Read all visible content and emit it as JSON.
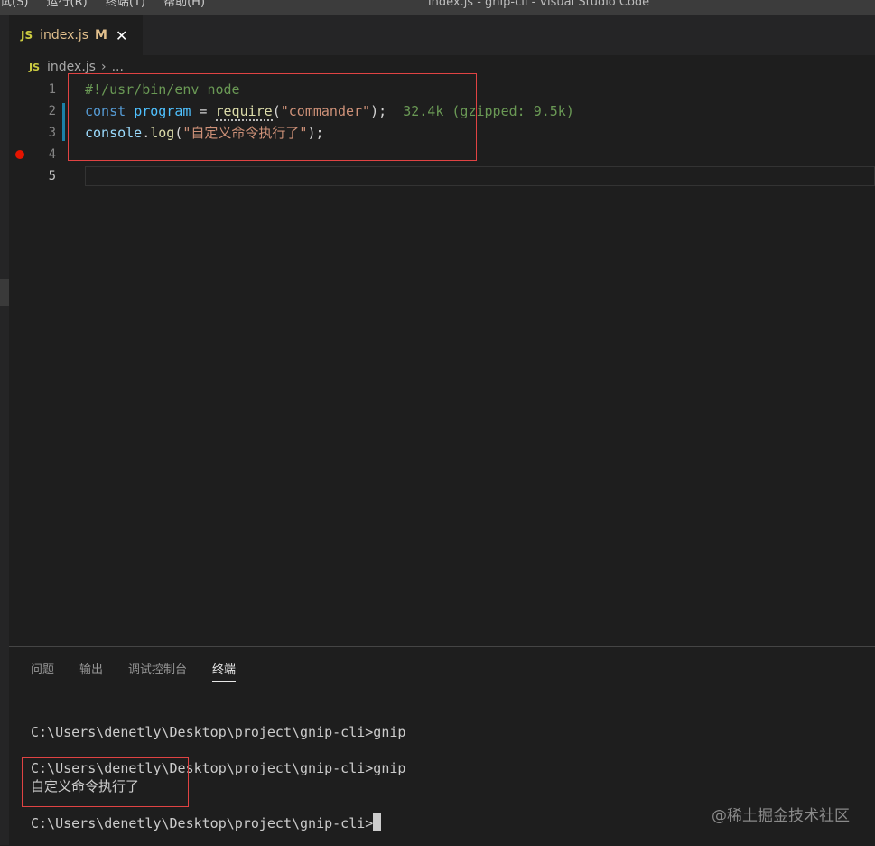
{
  "titlebar": {
    "menu": [
      "试(S)",
      "运行(R)",
      "终端(T)",
      "帮助(H)"
    ],
    "window_title": "index.js - gnip-cli - Visual Studio Code"
  },
  "tab": {
    "badge": "JS",
    "name": "index.js",
    "modified": "M",
    "close": "✕"
  },
  "breadcrumb": {
    "badge": "JS",
    "file": "index.js",
    "separator": "›",
    "more": "..."
  },
  "editor": {
    "line_numbers": [
      "1",
      "2",
      "3",
      "4",
      "5"
    ],
    "active_line": 5,
    "breakpoint_line": 4,
    "line1": {
      "comment": "#!/usr/bin/env node"
    },
    "line2": {
      "kw": "const",
      "var": "program",
      "eq": " = ",
      "fn": "require",
      "lparen": "(",
      "str": "\"commander\"",
      "rparen": ");",
      "size": "32.4k (gzipped: 9.5k)"
    },
    "line3": {
      "obj": "console",
      "dot": ".",
      "fn": "log",
      "lparen": "(",
      "str": "\"自定义命令执行了\"",
      "rparen": ");"
    }
  },
  "panel": {
    "tabs": [
      "问题",
      "输出",
      "调试控制台",
      "终端"
    ],
    "active_tab": "终端",
    "terminal": {
      "line1": "C:\\Users\\denetly\\Desktop\\project\\gnip-cli>gnip",
      "line2": "C:\\Users\\denetly\\Desktop\\project\\gnip-cli>gnip",
      "line3": "自定义命令执行了",
      "line4": "C:\\Users\\denetly\\Desktop\\project\\gnip-cli>"
    },
    "watermark": "@稀土掘金技术社区"
  },
  "colors": {
    "background": "#1e1e1e",
    "highlight_box": "#e04343",
    "breakpoint": "#e51400",
    "js_badge": "#cbcb41",
    "modified": "#e2c08d"
  }
}
